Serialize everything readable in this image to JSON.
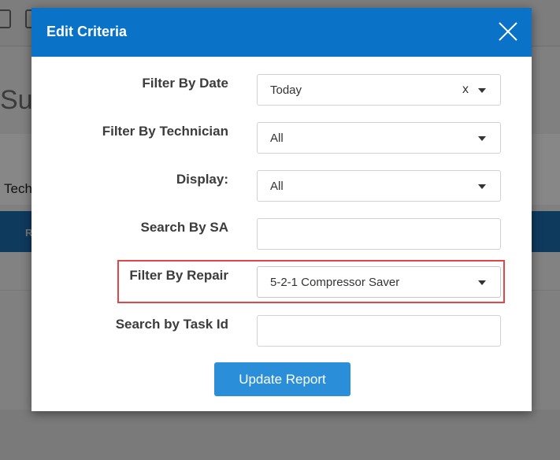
{
  "background": {
    "title_fragment": "Sur",
    "tech_fragment": "Tech",
    "bluebar_fragment": "R"
  },
  "modal": {
    "title": "Edit Criteria",
    "close_icon": "close-icon",
    "filters": [
      {
        "label": "Filter By Date",
        "value": "Today",
        "clear": "x",
        "type": "select"
      },
      {
        "label": "Filter By Technician",
        "value": "All",
        "type": "select"
      },
      {
        "label": "Display:",
        "value": "All",
        "type": "select"
      },
      {
        "label": "Search By SA",
        "value": "",
        "type": "input"
      },
      {
        "label": "Filter By Repair",
        "value": "5-2-1 Compressor Saver",
        "type": "select"
      },
      {
        "label": "Search by Task Id",
        "value": "",
        "type": "input"
      }
    ],
    "update_button": "Update Report"
  },
  "colors": {
    "header": "#0a72c7",
    "button": "#2a8fd8",
    "highlight": "#e2464b"
  }
}
